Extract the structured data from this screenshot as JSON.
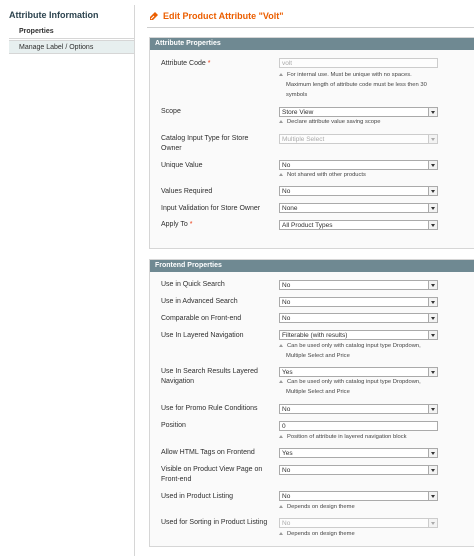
{
  "sidebar": {
    "title": "Attribute Information",
    "tabs": [
      {
        "label": "Properties"
      },
      {
        "label": "Manage Label / Options"
      }
    ]
  },
  "page": {
    "title": "Edit Product Attribute \"Volt\""
  },
  "attribute_properties": {
    "heading": "Attribute Properties",
    "attribute_code": {
      "label": "Attribute Code",
      "required": "*",
      "value": "volt",
      "note1": "For internal use. Must be unique with no spaces.",
      "note2": "Maximum length of attribute code must be less then 30",
      "note3": "symbols"
    },
    "scope": {
      "label": "Scope",
      "value": "Store View",
      "note": "Declare attribute value saving scope"
    },
    "input_type": {
      "label1": "Catalog Input Type for Store",
      "label2": "Owner",
      "value": "Multiple Select"
    },
    "unique_value": {
      "label": "Unique Value",
      "value": "No",
      "note": "Not shared with other products"
    },
    "values_required": {
      "label": "Values Required",
      "value": "No"
    },
    "input_validation": {
      "label": "Input Validation for Store Owner",
      "value": "None"
    },
    "apply_to": {
      "label": "Apply To",
      "required": "*",
      "value": "All Product Types"
    }
  },
  "frontend_properties": {
    "heading": "Frontend Properties",
    "quick_search": {
      "label": "Use in Quick Search",
      "value": "No"
    },
    "advanced_search": {
      "label": "Use in Advanced Search",
      "value": "No"
    },
    "comparable": {
      "label": "Comparable on Front-end",
      "value": "No"
    },
    "layered_nav": {
      "label": "Use In Layered Navigation",
      "value": "Filterable (with results)",
      "note1": "Can be used only with catalog input type Dropdown,",
      "note2": "Multiple Select and Price"
    },
    "search_layered_nav": {
      "label1": "Use In Search Results Layered",
      "label2": "Navigation",
      "value": "Yes",
      "note1": "Can be used only with catalog input type Dropdown,",
      "note2": "Multiple Select and Price"
    },
    "promo_rule": {
      "label": "Use for Promo Rule Conditions",
      "value": "No"
    },
    "position": {
      "label": "Position",
      "value": "0",
      "note": "Position of attribute in layered navigation block"
    },
    "html_tags": {
      "label": "Allow HTML Tags on Frontend",
      "value": "Yes"
    },
    "visible_view_page": {
      "label1": "Visible on Product View Page on",
      "label2": "Front-end",
      "value": "No"
    },
    "product_listing": {
      "label": "Used in Product Listing",
      "value": "No",
      "note": "Depends on design theme"
    },
    "sorting": {
      "label": "Used for Sorting in Product Listing",
      "value": "No",
      "note": "Depends on design theme"
    }
  }
}
